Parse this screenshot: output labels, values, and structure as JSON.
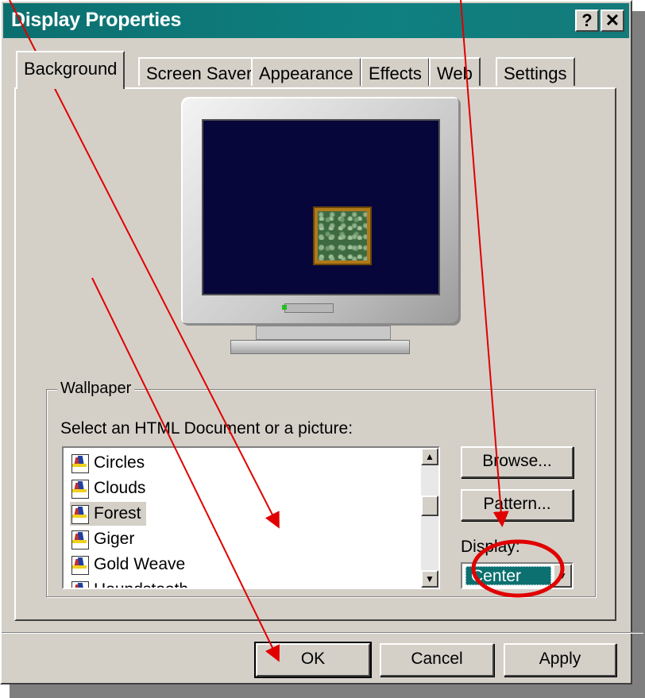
{
  "window": {
    "title": "Display Properties",
    "help_glyph": "?",
    "close_glyph": "✕"
  },
  "tabs": [
    {
      "label": "Background",
      "active": true
    },
    {
      "label": "Screen Saver",
      "active": false
    },
    {
      "label": "Appearance",
      "active": false
    },
    {
      "label": "Effects",
      "active": false
    },
    {
      "label": "Web",
      "active": false
    },
    {
      "label": "Settings",
      "active": false
    }
  ],
  "wallpaper": {
    "group_label": "Wallpaper",
    "select_label": "Select an HTML Document or a picture:",
    "items": [
      "Circles",
      "Clouds",
      "Forest",
      "Giger",
      "Gold Weave",
      "Houndstooth"
    ],
    "selected": "Forest",
    "browse_label": "Browse...",
    "pattern_label": "Pattern...",
    "display_label": "Display:",
    "display_value": "Center"
  },
  "footer": {
    "ok_label": "OK",
    "cancel_label": "Cancel",
    "apply_label": "Apply"
  },
  "annotation_color": "#e00000",
  "icons": {
    "scroll_up": "▲",
    "scroll_down": "▼",
    "dropdown": "▼"
  }
}
